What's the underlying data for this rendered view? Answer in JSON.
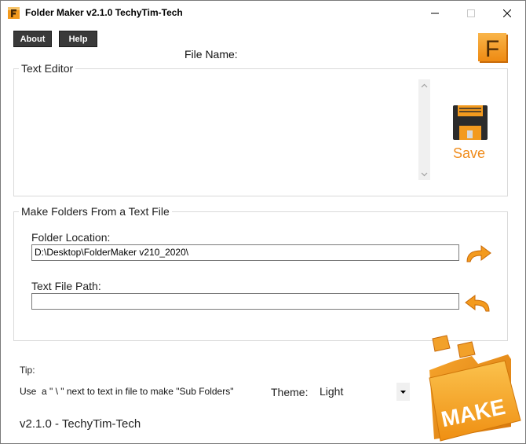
{
  "window": {
    "title": "Folder Maker v2.1.0 TechyTim-Tech"
  },
  "toolbar": {
    "about_label": "About",
    "help_label": "Help"
  },
  "editor": {
    "file_name_label": "File Name:",
    "group_title": "Text Editor",
    "save_label": "Save"
  },
  "make_folders": {
    "group_title": "Make Folders From a Text File",
    "folder_location_label": "Folder Location:",
    "folder_location_value": "D:\\Desktop\\FolderMaker v210_2020\\",
    "text_file_path_label": "Text File Path:",
    "text_file_path_value": ""
  },
  "footer": {
    "tip_label": "Tip:",
    "tip_text": "Use  a \" \\ \" next to text in file to make \"Sub Folders\"",
    "theme_label": "Theme:",
    "theme_value": "Light",
    "version_text": "v2.1.0 - TechyTim-Tech",
    "make_graphic_text": "MAKE"
  },
  "logo": {
    "letter": "F"
  },
  "colors": {
    "accent_orange": "#f08c1c",
    "dark_button": "#3a3a3a",
    "logo_orange": "#f39a1e"
  }
}
